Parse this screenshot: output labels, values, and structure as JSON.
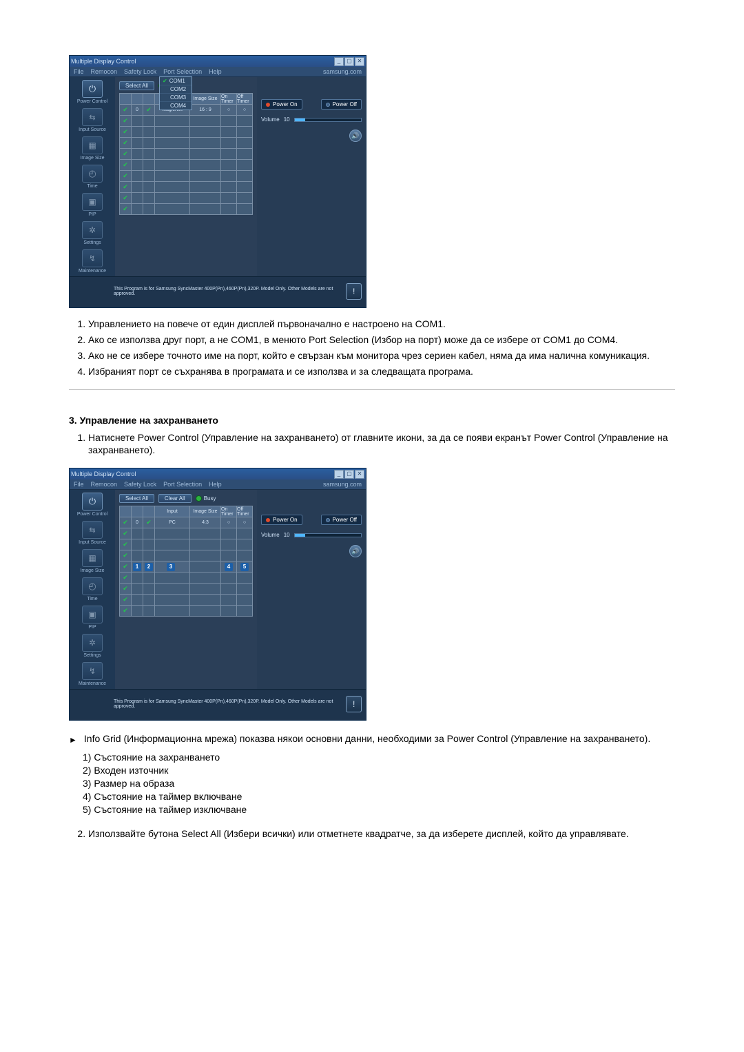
{
  "app": {
    "title": "Multiple Display Control",
    "menus": {
      "file": "File",
      "remocon": "Remocon",
      "safety": "Safety Lock",
      "port": "Port Selection",
      "help": "Help"
    },
    "status_link": "samsung.com",
    "select_all": "Select All",
    "clear_all": "Clear All",
    "busy": "Busy",
    "com_options": [
      "COM1",
      "COM2",
      "COM3",
      "COM4"
    ],
    "grid_headers": {
      "c1": "",
      "c2": "",
      "c3": "",
      "input": "Input",
      "size": "Image Size",
      "on": "On Timer",
      "off": "Off Timer"
    },
    "row1": {
      "input": "MagicNet",
      "size": "16 : 9",
      "on": "○",
      "off": "○"
    },
    "row1b": {
      "input": "PC",
      "size": "4:3",
      "on": "○",
      "off": "○"
    },
    "sidebar": {
      "power": "Power Control",
      "input": "Input Source",
      "image": "Image Size",
      "time": "Time",
      "pip": "PIP",
      "settings": "Settings",
      "maint": "Maintenance"
    },
    "power_on": "Power On",
    "power_off": "Power Off",
    "volume_label": "Volume",
    "volume_value": "10",
    "footer_text": "This Program is for Samsung SyncMaster 400P(Pn),460P(Pn),320P. Model Only. Other Models are not approved."
  },
  "grid2_labels": [
    "1",
    "2",
    "3",
    "4",
    "5"
  ],
  "text": {
    "list1": {
      "i1": "Управлението на повече от един дисплей първоначално е настроено на COM1.",
      "i2": "Ако се използва друг порт, а не COM1, в менюто Port Selection (Избор на порт) може да се избере от COM1 до COM4.",
      "i3": "Ако не се избере точното име на порт, който е свързан към монитора чрез сериен кабел, няма да има налична комуникация.",
      "i4": "Избраният порт се съхранява в програмата и се използва и за следващата програма."
    },
    "sec3_title": "3. Управление на захранването",
    "sec3_i1": "Натиснете Power Control (Управление на захранването) от главните икони, за да се появи екранът Power Control (Управление на захранването).",
    "arrow_note": "Info Grid (Информационна мрежа) показва някои основни данни, необходими за Power Control (Управление на захранването).",
    "sub": {
      "s1": "1) Състояние на захранването",
      "s2": "2) Входен източник",
      "s3": "3) Размер на образа",
      "s4": "4) Състояние на таймер включване",
      "s5": "5) Състояние на таймер изключване"
    },
    "sec3_i2": "Използвайте бутона Select All (Избери всички) или отметнете квадратче, за да изберете дисплей, който да управлявате."
  }
}
